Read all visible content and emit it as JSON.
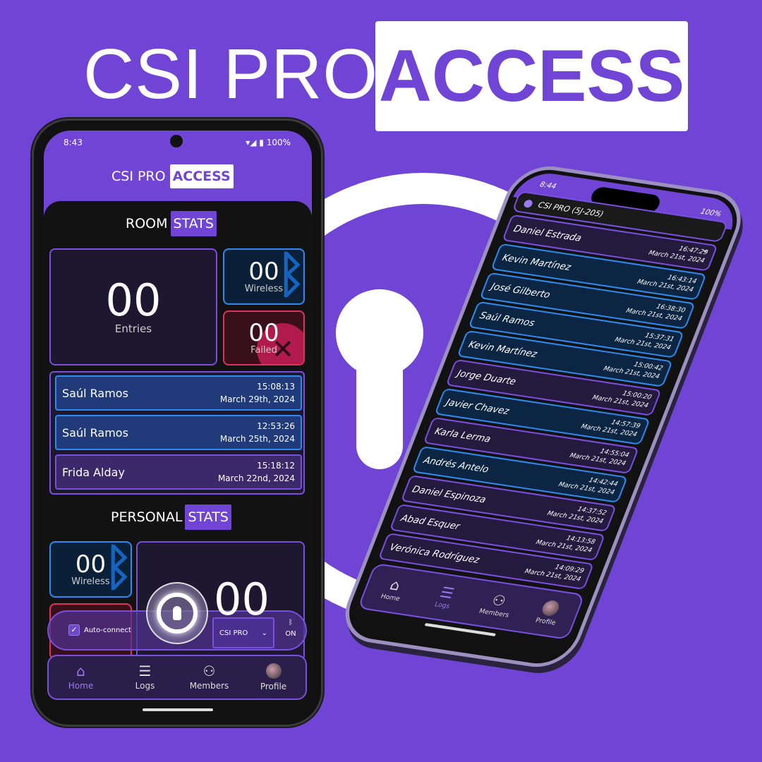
{
  "hero": {
    "title_a": "CSI PRO",
    "title_b": "ACCESS",
    "background": "#7045d6"
  },
  "android": {
    "status": {
      "time": "8:43",
      "battery": "100%"
    },
    "app_title": {
      "a": "CSI PRO",
      "b": "ACCESS"
    },
    "room_stats": {
      "a": "ROOM",
      "b": "STATS",
      "entries": {
        "value": "00",
        "label": "Entries"
      },
      "wireless": {
        "value": "00",
        "label": "Wireless"
      },
      "failed": {
        "value": "00",
        "label": "Failed"
      }
    },
    "recent": [
      {
        "name": "Saúl Ramos",
        "time": "15:08:13",
        "date": "March 29th, 2024",
        "type": "wireless"
      },
      {
        "name": "Saúl Ramos",
        "time": "12:53:26",
        "date": "March 25th, 2024",
        "type": "wireless"
      },
      {
        "name": "Frida Alday",
        "time": "15:18:12",
        "date": "March 22nd, 2024",
        "type": "other"
      }
    ],
    "personal_stats": {
      "a": "PERSONAL",
      "b": "STATS",
      "wireless": {
        "value": "00",
        "label": "Wireless"
      },
      "entries": {
        "value": "00"
      }
    },
    "control": {
      "auto_connect": "Auto-connect",
      "auto_connect_checked": true,
      "room_select": "CSI PRO",
      "bluetooth": "ON"
    },
    "nav": [
      {
        "label": "Home",
        "icon": "home-icon",
        "active": true
      },
      {
        "label": "Logs",
        "icon": "list-icon"
      },
      {
        "label": "Members",
        "icon": "users-icon"
      },
      {
        "label": "Profile",
        "icon": "avatar"
      }
    ]
  },
  "iphone": {
    "status": {
      "time": "8:44",
      "battery": "100%"
    },
    "location": "CSI PRO (5J-205)",
    "logs": [
      {
        "name": "Daniel Estrada",
        "time": "16:47:29",
        "date": "March 21st, 2024",
        "type": "other"
      },
      {
        "name": "Kevin Martínez",
        "time": "16:43:14",
        "date": "March 21st, 2024",
        "type": "wireless"
      },
      {
        "name": "José Gilberto",
        "time": "16:38:30",
        "date": "March 21st, 2024",
        "type": "wireless"
      },
      {
        "name": "Saúl Ramos",
        "time": "15:37:31",
        "date": "March 21st, 2024",
        "type": "wireless"
      },
      {
        "name": "Kevin Martínez",
        "time": "15:00:42",
        "date": "March 21st, 2024",
        "type": "wireless"
      },
      {
        "name": "Jorge Duarte",
        "time": "15:00:20",
        "date": "March 21st, 2024",
        "type": "other"
      },
      {
        "name": "Javier Chavez",
        "time": "14:57:39",
        "date": "March 21st, 2024",
        "type": "wireless"
      },
      {
        "name": "Karla Lerma",
        "time": "14:55:04",
        "date": "March 21st, 2024",
        "type": "other"
      },
      {
        "name": "Andrés Antelo",
        "time": "14:42:44",
        "date": "March 21st, 2024",
        "type": "wireless"
      },
      {
        "name": "Daniel Espinoza",
        "time": "14:37:52",
        "date": "March 21st, 2024",
        "type": "other"
      },
      {
        "name": "Abad Esquer",
        "time": "14:13:58",
        "date": "March 21st, 2024",
        "type": "other"
      },
      {
        "name": "Verónica Rodríguez",
        "time": "14:09:29",
        "date": "March 21st, 2024",
        "type": "other"
      }
    ],
    "nav": [
      {
        "label": "Home",
        "icon": "home-icon"
      },
      {
        "label": "Logs",
        "icon": "list-icon",
        "active": true
      },
      {
        "label": "Members",
        "icon": "users-icon"
      },
      {
        "label": "Profile",
        "icon": "avatar"
      }
    ]
  }
}
